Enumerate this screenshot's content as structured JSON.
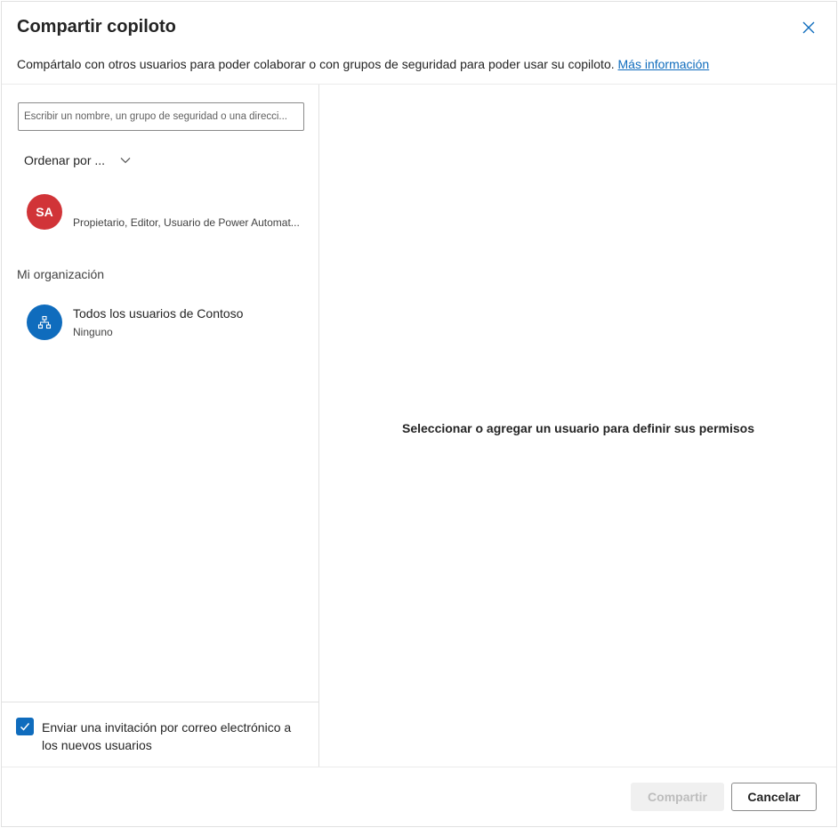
{
  "dialog": {
    "title": "Compartir copiloto",
    "subtitle": "Compártalo con otros usuarios para poder colaborar o con grupos de seguridad para poder usar su copiloto.",
    "more_info_link": "Más información"
  },
  "left_panel": {
    "search_placeholder": "Escribir un nombre, un grupo de seguridad o una direcci...",
    "sort_label": "Ordenar por ...",
    "users": [
      {
        "initials": "SA",
        "roles": "Propietario, Editor, Usuario de Power Automat...",
        "avatar_color": "#d13438"
      }
    ],
    "section_label": "Mi organización",
    "org": {
      "name": "Todos los usuarios de Contoso",
      "permission": "Ninguno",
      "icon": "org-chart-icon",
      "avatar_color": "#0f6cbd"
    },
    "email_invite": {
      "label": "Enviar una invitación por correo electrónico a los nuevos usuarios",
      "checked": true
    }
  },
  "right_panel": {
    "empty_message": "Seleccionar o agregar un usuario para definir sus permisos"
  },
  "footer": {
    "share_label": "Compartir",
    "cancel_label": "Cancelar"
  },
  "colors": {
    "accent": "#0f6cbd",
    "user_avatar": "#d13438"
  }
}
